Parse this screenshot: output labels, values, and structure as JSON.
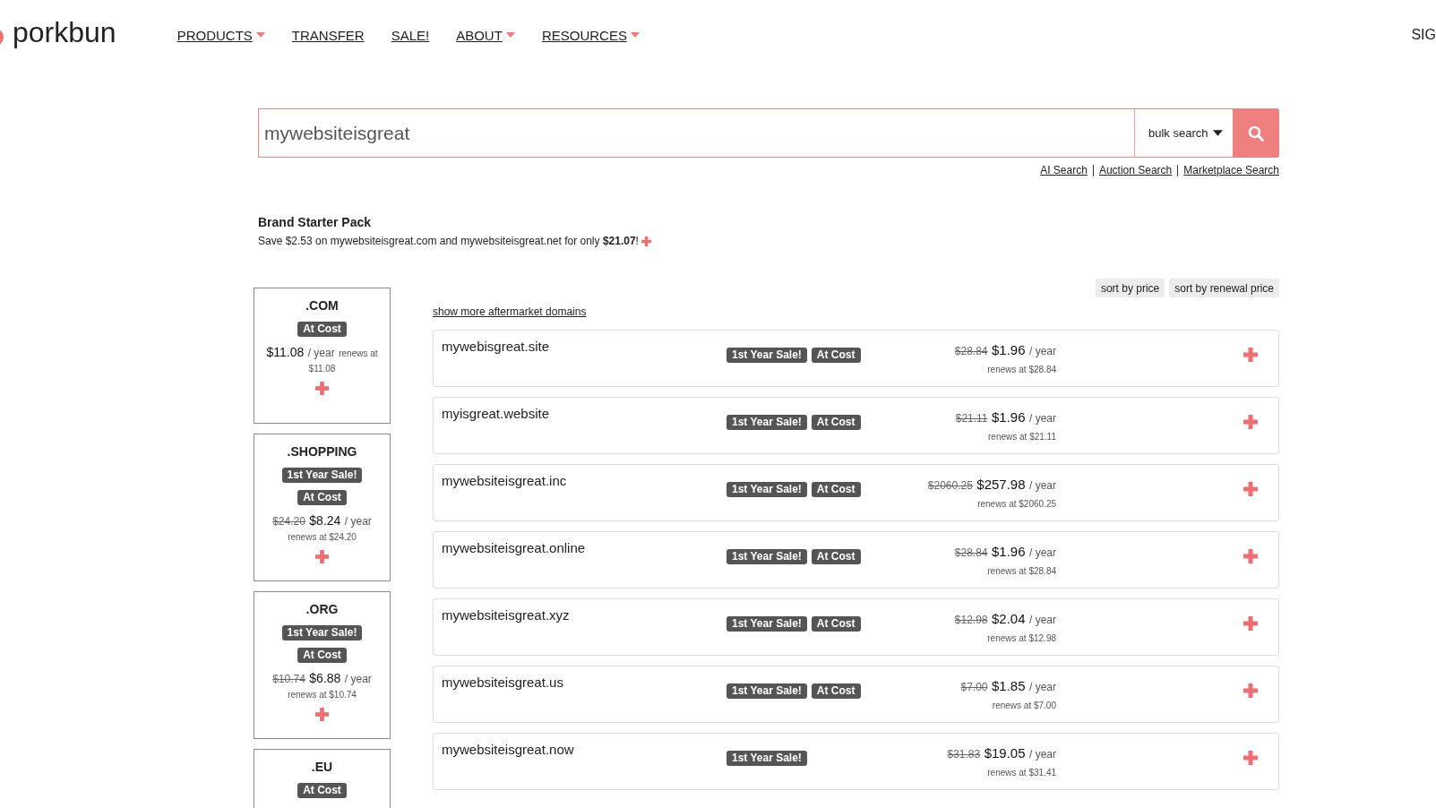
{
  "header": {
    "logo": "porkbun",
    "nav": [
      {
        "label": "PRODUCTS",
        "dropdown": true
      },
      {
        "label": "TRANSFER",
        "dropdown": false
      },
      {
        "label": "SALE!",
        "dropdown": false
      },
      {
        "label": "ABOUT",
        "dropdown": true
      },
      {
        "label": "RESOURCES",
        "dropdown": true
      }
    ],
    "account_link": "SIG"
  },
  "search": {
    "value": "mywebsiteisgreat",
    "bulk_label": "bulk search",
    "links": [
      "AI Search",
      "Auction Search",
      "Marketplace Search"
    ]
  },
  "starter_pack": {
    "title": "Brand Starter Pack",
    "text": "Save $2.53 on mywebsiteisgreat.com and mywebsiteisgreat.net for only **$21.07**!"
  },
  "featured_tlds": [
    {
      "tld": ".COM",
      "tags": [
        "At Cost"
      ],
      "price": "$11.08",
      "period": "/ year",
      "renewal": "renews at $11.08"
    },
    {
      "tld": ".SHOPPING",
      "tags": [
        "1st Year Sale!",
        "At Cost"
      ],
      "old_price": "$24.20",
      "price": "$8.24",
      "period": "/ year",
      "renewal": "renews at $24.20"
    },
    {
      "tld": ".ORG",
      "tags": [
        "1st Year Sale!",
        "At Cost"
      ],
      "old_price": "$10.74",
      "price": "$6.88",
      "period": "/ year",
      "renewal": "renews at $10.74"
    },
    {
      "tld": ".EU",
      "tags": [
        "At Cost"
      ]
    }
  ],
  "sort_buttons": [
    "sort by price",
    "sort by renewal price"
  ],
  "aftermarket_link": "show more aftermarket domains",
  "results": [
    {
      "domain": "mywebisgreat.site",
      "tags": [
        "1st Year Sale!",
        "At Cost"
      ],
      "old_price": "$28.84",
      "price": "$1.96",
      "period": "/ year",
      "renewal": "renews at $28.84"
    },
    {
      "domain": "myisgreat.website",
      "tags": [
        "1st Year Sale!",
        "At Cost"
      ],
      "old_price": "$21.11",
      "price": "$1.96",
      "period": "/ year",
      "renewal": "renews at $21.11"
    },
    {
      "domain": "mywebsiteisgreat.inc",
      "tags": [
        "1st Year Sale!",
        "At Cost"
      ],
      "old_price": "$2060.25",
      "price": "$257.98",
      "period": "/ year",
      "renewal": "renews at $2060.25"
    },
    {
      "domain": "mywebsiteisgreat.online",
      "tags": [
        "1st Year Sale!",
        "At Cost"
      ],
      "old_price": "$28.84",
      "price": "$1.96",
      "period": "/ year",
      "renewal": "renews at $28.84"
    },
    {
      "domain": "mywebsiteisgreat.xyz",
      "tags": [
        "1st Year Sale!",
        "At Cost"
      ],
      "old_price": "$12.98",
      "price": "$2.04",
      "period": "/ year",
      "renewal": "renews at $12.98"
    },
    {
      "domain": "mywebsiteisgreat.us",
      "tags": [
        "1st Year Sale!",
        "At Cost"
      ],
      "old_price": "$7.00",
      "price": "$1.85",
      "period": "/ year",
      "renewal": "renews at $7.00"
    },
    {
      "domain": "mywebsiteisgreat.now",
      "tags": [
        "1st Year Sale!"
      ],
      "old_price": "$31.83",
      "price": "$19.05",
      "period": "/ year",
      "renewal": "renews at $31.41"
    }
  ]
}
